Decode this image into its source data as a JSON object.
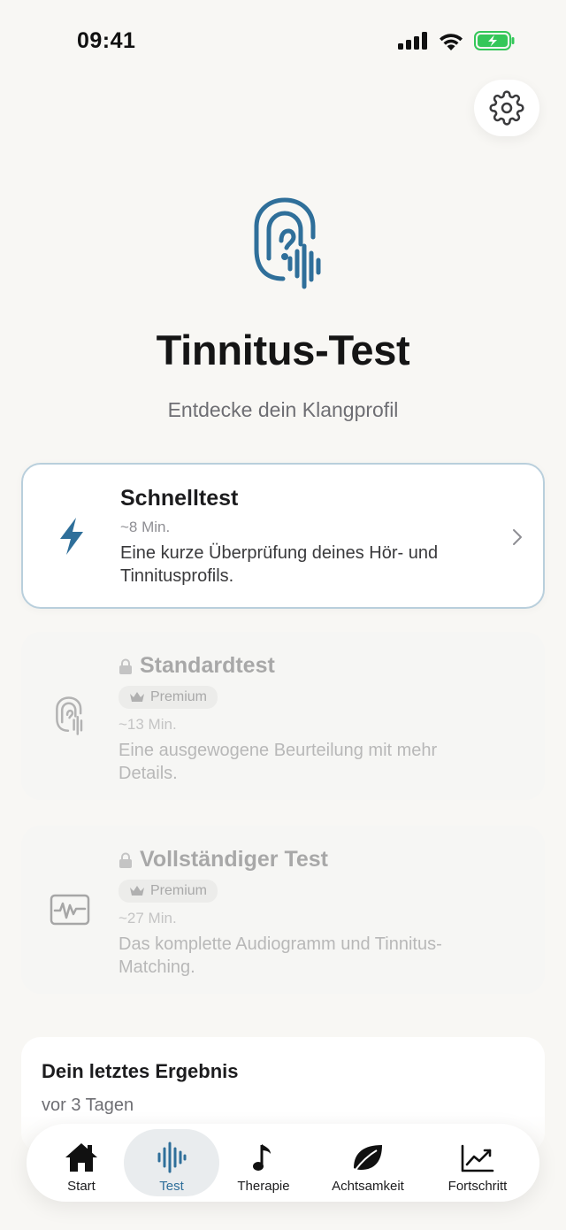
{
  "status_bar": {
    "time": "09:41"
  },
  "header": {
    "title": "Tinnitus-Test",
    "subtitle": "Entdecke dein Klangprofil"
  },
  "colors": {
    "accent": "#2f6f9a",
    "background": "#f8f7f4",
    "battery": "#34c759"
  },
  "tests": [
    {
      "title": "Schnelltest",
      "duration": "~8 Min.",
      "description": "Eine kurze Überprüfung deines Hör- und Tinnitusprofils.",
      "icon": "lightning-icon",
      "locked": false
    },
    {
      "title": "Standardtest",
      "badge": "Premium",
      "duration": "~13 Min.",
      "description": "Eine ausgewogene Beurteilung mit mehr Details.",
      "icon": "ear-icon",
      "locked": true
    },
    {
      "title": "Vollständiger Test",
      "badge": "Premium",
      "duration": "~27 Min.",
      "description": "Das komplette Audiogramm und Tinnitus-Matching.",
      "icon": "waveform-monitor-icon",
      "locked": true
    }
  ],
  "last_result": {
    "title": "Dein letztes Ergebnis",
    "subtitle": "vor 3 Tagen"
  },
  "nav": [
    {
      "label": "Start",
      "icon": "home-icon",
      "active": false
    },
    {
      "label": "Test",
      "icon": "soundwave-icon",
      "active": true
    },
    {
      "label": "Therapie",
      "icon": "music-note-icon",
      "active": false
    },
    {
      "label": "Achtsamkeit",
      "icon": "leaf-icon",
      "active": false
    },
    {
      "label": "Fortschritt",
      "icon": "chart-icon",
      "active": false
    }
  ]
}
